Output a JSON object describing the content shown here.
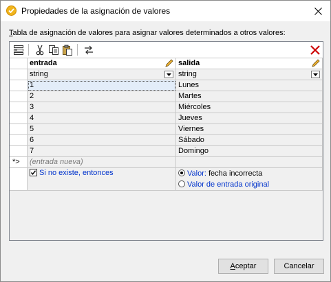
{
  "window": {
    "title": "Propiedades de la asignación de valores",
    "close_symbol": "✕"
  },
  "description": {
    "underlined_char": "T",
    "rest": "abla de asignación de valores para asignar valores determinados a otros valores:"
  },
  "toolbar": {
    "icons": [
      "insert-row-icon",
      "cut-icon",
      "copy-icon",
      "paste-icon",
      "swap-icon",
      "delete-icon"
    ]
  },
  "table": {
    "columns": [
      {
        "label": "entrada",
        "type": "string"
      },
      {
        "label": "salida",
        "type": "string"
      }
    ],
    "rows": [
      {
        "input": "1",
        "output": "Lunes"
      },
      {
        "input": "2",
        "output": "Martes"
      },
      {
        "input": "3",
        "output": "Miércoles"
      },
      {
        "input": "4",
        "output": "Jueves"
      },
      {
        "input": "5",
        "output": "Viernes"
      },
      {
        "input": "6",
        "output": "Sábado"
      },
      {
        "input": "7",
        "output": "Domingo"
      }
    ],
    "new_row_marker": "*>",
    "new_row_placeholder": "(entrada nueva)"
  },
  "otherwise": {
    "checkbox_label": "Si no existe, entonces",
    "checked": true,
    "option_value_label": "Valor:",
    "option_value_text": "fecha incorrecta",
    "option_value_selected": true,
    "option_original_label": "Valor de entrada original",
    "option_original_selected": false
  },
  "buttons": {
    "ok_underlined": "A",
    "ok_rest": "ceptar",
    "cancel": "Cancelar"
  },
  "colors": {
    "app_icon": "#f1b51c",
    "link_blue": "#0033cc",
    "delete_red": "#cc0000",
    "selected_cell": "#e3edf9"
  }
}
